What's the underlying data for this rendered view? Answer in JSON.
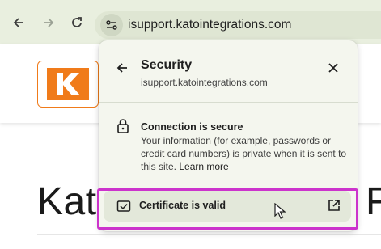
{
  "browser": {
    "url": "isupport.katointegrations.com",
    "icons": [
      "back-arrow-icon",
      "forward-arrow-icon",
      "reload-icon",
      "site-info-icon"
    ]
  },
  "page": {
    "logo_letter": "K",
    "heading_left": "Kat",
    "heading_right": "F",
    "colors": {
      "logo_orange": "#f07b1a",
      "toolbar_bg": "#e9efdf"
    }
  },
  "popup": {
    "title": "Security",
    "subtitle": "isupport.katointegrations.com",
    "connection_title": "Connection is secure",
    "connection_desc": "Your information (for example, passwords or credit card numbers) is private when it is sent to this site.",
    "learn_more": "Learn more",
    "certificate_label": "Certificate is valid",
    "icons": [
      "back-arrow-icon",
      "close-icon",
      "lock-icon",
      "certificate-icon",
      "external-link-icon"
    ]
  },
  "annotation": {
    "highlight_color": "#cc33cc"
  }
}
